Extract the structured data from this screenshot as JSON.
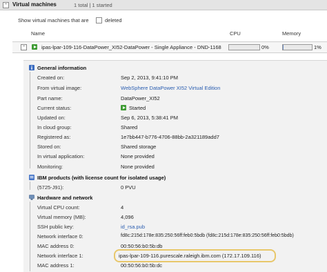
{
  "header": {
    "toggle_glyph": "−",
    "title": "Virtual machines",
    "summary": "1 total | 1 started"
  },
  "filter": {
    "prefix": "Show virtual machines that are",
    "deleted_label": "deleted",
    "deleted_checked": false
  },
  "columns": {
    "name": "Name",
    "cpu": "CPU",
    "memory": "Memory"
  },
  "vm": {
    "expand_glyph": "−",
    "status_icon": "started-play-icon",
    "name": "ipas-lpar-109-116-DataPower_XI52-DataPower - Single Appliance - DND-1168",
    "cpu_percent": 0,
    "cpu_label": "0%",
    "memory_percent": 1,
    "memory_label": "1%"
  },
  "general": {
    "title": "General information",
    "created_on_label": "Created on:",
    "created_on": "Sep 2, 2013, 9:41:10 PM",
    "from_image_label": "From virtual image:",
    "from_image": "WebSphere DataPower XI52 Virtual Edition",
    "part_name_label": "Part name:",
    "part_name": "DataPower_XI52",
    "status_label": "Current status:",
    "status": "Started",
    "updated_on_label": "Updated on:",
    "updated_on": "Sep 6, 2013, 5:38:41 PM",
    "cloud_group_label": "In cloud group:",
    "cloud_group": "Shared",
    "registered_as_label": "Registered as:",
    "registered_as": "1e7bb447-b776-4706-88bb-2a321189add7",
    "stored_on_label": "Stored on:",
    "stored_on": "Shared storage",
    "virtual_app_label": "In virtual application:",
    "virtual_app": "None provided",
    "monitoring_label": "Monitoring:",
    "monitoring": "None provided"
  },
  "ibm_products": {
    "title": "IBM products (with license count for isolated usage)",
    "product_label": "(5725-J91):",
    "product_value": "0 PVU"
  },
  "hardware": {
    "title": "Hardware and network",
    "vcpu_label": "Virtual CPU count:",
    "vcpu": "4",
    "vmem_label": "Virtual memory (MB):",
    "vmem": "4,096",
    "ssh_label": "SSH public key:",
    "ssh": "id_rsa.pub",
    "ni0_label": "Network interface 0:",
    "ni0": "fd8c:215d:178e:835:250:56ff:feb0:5bdb (fd8c:215d:178e:835:250:56ff:feb0:5bdb)",
    "mac0_label": "MAC address 0:",
    "mac0": "00:50:56:b0:5b:db",
    "ni1_label": "Network interface 1:",
    "ni1": "ipas-lpar-109-116.purescale.raleigh.ibm.com (172.17.109.116)",
    "mac1_label": "MAC address 1:",
    "mac1": "00:50:56:b0:5b:dc"
  },
  "colors": {
    "started_green": "#3f9c35",
    "link_blue": "#2a5db0",
    "highlight": "#e8c76a"
  }
}
